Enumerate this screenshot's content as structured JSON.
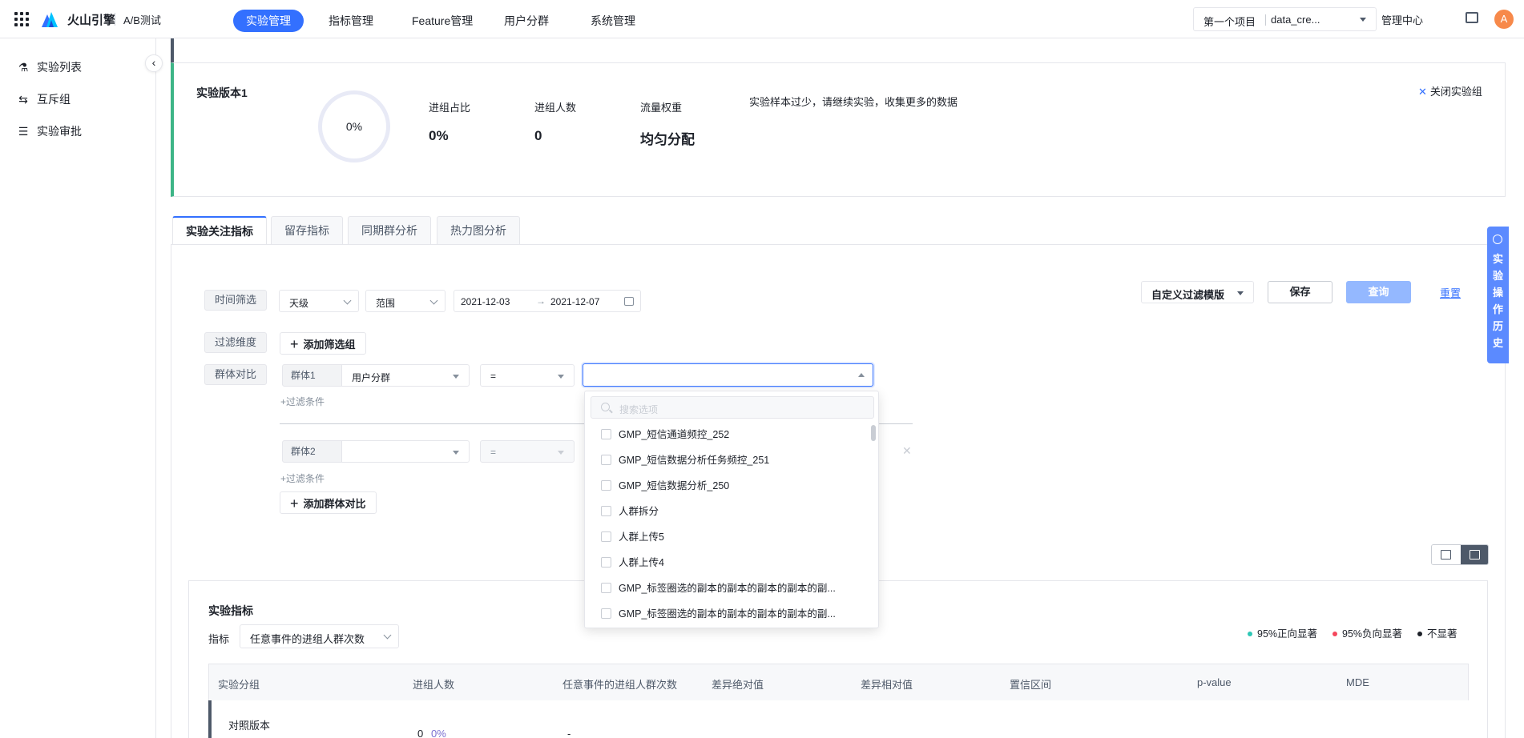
{
  "topbar": {
    "brand": "火山引擎",
    "sub_brand": "A/B测试",
    "nav": [
      "实验管理",
      "指标管理",
      "Feature管理",
      "用户分群",
      "系统管理"
    ],
    "active_nav": "实验管理",
    "project_name": "第一个项目",
    "project_data": "data_cre...",
    "management_center": "管理中心",
    "avatar_initial": "A",
    "accent_color": "#3370ff"
  },
  "sidebar": {
    "items": [
      {
        "label": "实验列表",
        "icon": "flask-icon"
      },
      {
        "label": "互斥组",
        "icon": "swap-icon"
      },
      {
        "label": "实验审批",
        "icon": "sliders-icon"
      }
    ]
  },
  "version_card": {
    "title": "实验版本1",
    "donut_value": "0%",
    "stats": [
      {
        "label": "进组占比",
        "value": "0%"
      },
      {
        "label": "进组人数",
        "value": "0"
      },
      {
        "label": "流量权重",
        "value": "均匀分配"
      }
    ],
    "note": "实验样本过少，请继续实验，收集更多的数据",
    "close_label": "关闭实验组"
  },
  "tabs": [
    "实验关注指标",
    "留存指标",
    "同期群分析",
    "热力图分析"
  ],
  "filters": {
    "time_label": "时间筛选",
    "granularity": "天级",
    "range": "范围",
    "date_start": "2021-12-03",
    "date_arrow": "→",
    "date_end": "2021-12-07",
    "dimension_label": "过滤维度",
    "add_filter_group": "添加筛选组",
    "group_compare_label": "群体对比",
    "group1": {
      "tag": "群体1",
      "field": "用户分群",
      "op": "="
    },
    "group2": {
      "tag": "群体2",
      "field": "",
      "op": "="
    },
    "add_condition": "+过滤条件",
    "add_group_compare": "添加群体对比",
    "custom_template": "自定义过滤模版",
    "save": "保存",
    "query": "查询",
    "reset": "重置"
  },
  "dropdown": {
    "placeholder": "搜索选项",
    "options": [
      "GMP_短信通道频控_252",
      "GMP_短信数据分析任务频控_251",
      "GMP_短信数据分析_250",
      "人群拆分",
      "人群上传5",
      "人群上传4",
      "GMP_标签圈选的副本的副本的副本的副本的副...",
      "GMP_标签圈选的副本的副本的副本的副本的副..."
    ]
  },
  "metrics": {
    "title": "实验指标",
    "metric_label": "指标",
    "metric_value": "任意事件的进组人群次数",
    "legend": [
      {
        "label": "95%正向显著",
        "color": "#2ec7b6"
      },
      {
        "label": "95%负向显著",
        "color": "#f5475c"
      },
      {
        "label": "不显著",
        "color": "#1d2129"
      }
    ],
    "columns": [
      "实验分组",
      "进组人数",
      "任意事件的进组人群次数",
      "差异绝对值",
      "差异相对值",
      "置信区间",
      "p-value",
      "MDE"
    ],
    "row": {
      "group": "对照版本",
      "count": "0",
      "pct": "0%",
      "value": "-"
    }
  },
  "history_button": "实验操作历史"
}
